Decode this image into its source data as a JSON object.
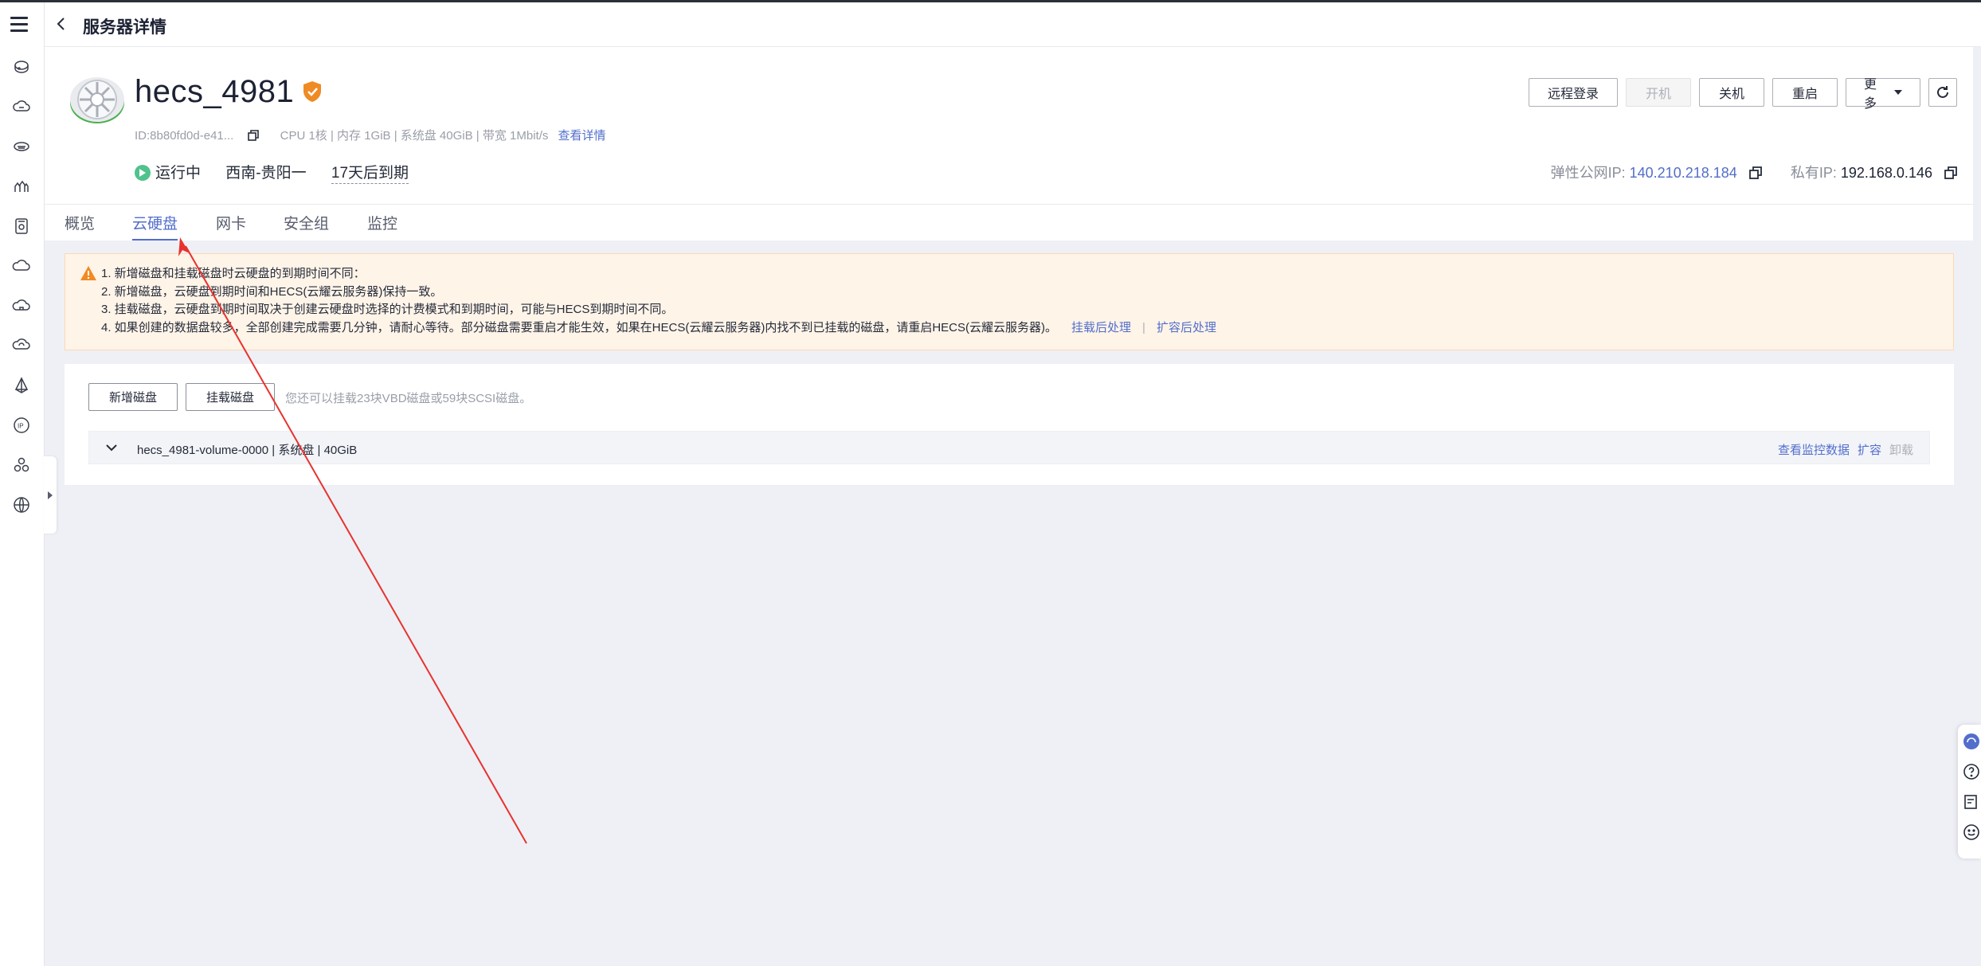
{
  "header": {
    "back_icon": "chevron-left-icon",
    "title": "服务器详情"
  },
  "rail": {
    "menu_icon": "hamburger-menu-icon",
    "items": [
      "cloud-server-icon",
      "cloud-icon",
      "database-icon",
      "cluster-icon",
      "storage-icon",
      "cloud-outline-icon",
      "cloud-home-icon",
      "cloud-sync-icon",
      "deploy-icon",
      "ip-icon",
      "triangle-nodes-icon",
      "globe-icon"
    ]
  },
  "server": {
    "name": "hecs_4981",
    "id": "ID:8b80fd0d-e41...",
    "specs": "CPU 1核 | 内存 1GiB | 系统盘 40GiB | 带宽 1Mbit/s",
    "details_link": "查看详情",
    "status": "运行中",
    "region": "西南-贵阳一",
    "expiry": "17天后到期",
    "public_ip_label": "弹性公网IP:",
    "public_ip": "140.210.218.184",
    "private_ip_label": "私有IP:",
    "private_ip": "192.168.0.146"
  },
  "actions": {
    "remote_login": "远程登录",
    "power_on": "开机",
    "shutdown": "关机",
    "restart": "重启",
    "more": "更多"
  },
  "tabs": [
    "概览",
    "云硬盘",
    "网卡",
    "安全组",
    "监控"
  ],
  "notice": {
    "lines": [
      "1. 新增磁盘和挂载磁盘时云硬盘的到期时间不同：",
      "2. 新增磁盘，云硬盘到期时间和HECS(云耀云服务器)保持一致。",
      "3. 挂载磁盘，云硬盘到期时间取决于创建云硬盘时选择的计费模式和到期时间，可能与HECS到期时间不同。",
      "4. 如果创建的数据盘较多，全部创建完成需要几分钟，请耐心等待。部分磁盘需要重启才能生效，如果在HECS(云耀云服务器)内找不到已挂载的磁盘，请重启HECS(云耀云服务器)。"
    ],
    "link_mount": "挂载后处理",
    "link_expand": "扩容后处理"
  },
  "disks": {
    "add_button": "新增磁盘",
    "attach_button": "挂载磁盘",
    "hint": "您还可以挂载23块VBD磁盘或59块SCSI磁盘。",
    "rows": [
      {
        "name": "hecs_4981-volume-0000 | 系统盘 | 40GiB",
        "monitor": "查看监控数据",
        "expand": "扩容",
        "detach": "卸载"
      }
    ]
  },
  "colors": {
    "accent": "#526ecc",
    "status_running": "#50c28c",
    "warning": "#f08a24",
    "annotation": "#e8322e"
  }
}
